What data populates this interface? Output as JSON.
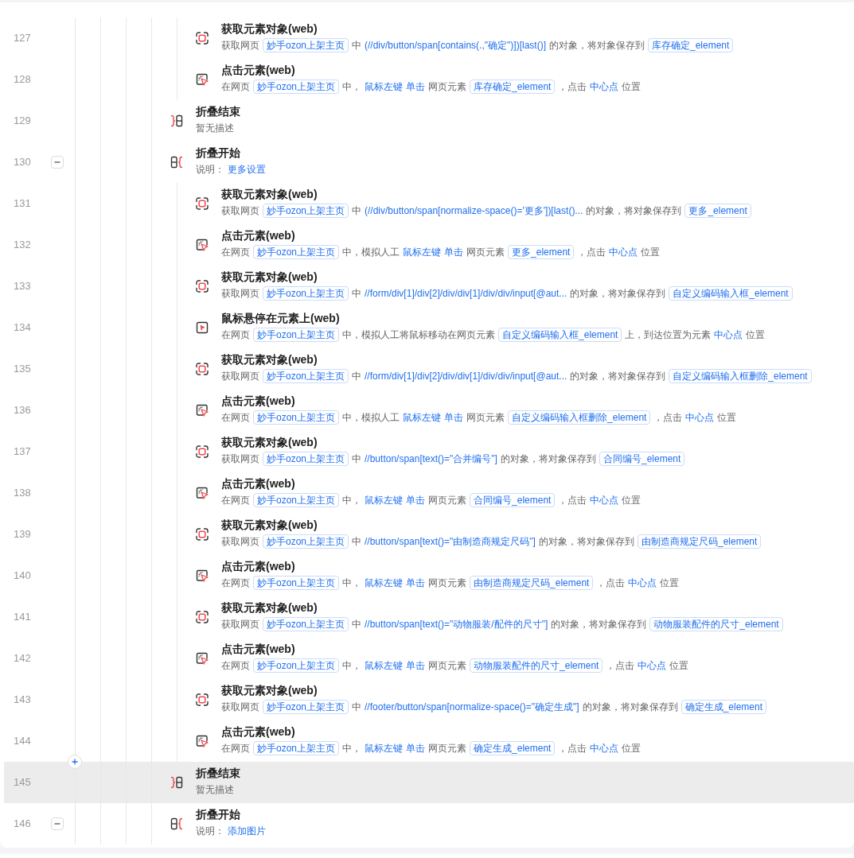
{
  "steps": [
    {
      "kind": "continuation",
      "children": [
        {
          "kind": "get_element",
          "line": "127",
          "title": "获取元素对象(web)",
          "selected": false,
          "description": [
            {
              "kind": "text",
              "text": "获取网页"
            },
            {
              "kind": "chip",
              "text": "妙手ozon上架主页"
            },
            {
              "kind": "text",
              "text": "中"
            },
            {
              "kind": "value",
              "text": "(//div/button/span[contains(.,\"确定\")])[last()]"
            },
            {
              "kind": "text",
              "text": "的对象，将对象保存到"
            },
            {
              "kind": "chip",
              "text": "库存确定_element"
            }
          ]
        },
        {
          "kind": "click",
          "line": "128",
          "title": "点击元素(web)",
          "selected": false,
          "description": [
            {
              "kind": "text",
              "text": "在网页"
            },
            {
              "kind": "chip",
              "text": "妙手ozon上架主页"
            },
            {
              "kind": "text",
              "text": "中，"
            },
            {
              "kind": "value",
              "text": "鼠标左键"
            },
            {
              "kind": "value",
              "text": "单击"
            },
            {
              "kind": "text",
              "text": "网页元素"
            },
            {
              "kind": "chip",
              "text": "库存确定_element"
            },
            {
              "kind": "text",
              "text": "，点击"
            },
            {
              "kind": "value",
              "text": "中心点"
            },
            {
              "kind": "text",
              "text": "位置"
            }
          ]
        }
      ]
    },
    {
      "kind": "fold_end",
      "line": "129",
      "title": "折叠结束",
      "selected": false,
      "description": [
        {
          "kind": "text",
          "text": "暂无描述"
        }
      ]
    },
    {
      "kind": "fold_start",
      "line": "130",
      "title": "折叠开始",
      "expanded": true,
      "selected": false,
      "description": [
        {
          "kind": "text",
          "text": "说明："
        },
        {
          "kind": "value",
          "text": "更多设置"
        }
      ],
      "children": [
        {
          "kind": "get_element",
          "line": "131",
          "title": "获取元素对象(web)",
          "selected": false,
          "description": [
            {
              "kind": "text",
              "text": "获取网页"
            },
            {
              "kind": "chip",
              "text": "妙手ozon上架主页"
            },
            {
              "kind": "text",
              "text": "中"
            },
            {
              "kind": "value",
              "text": "(//div/button/span[normalize-space()='更多'])[last()..."
            },
            {
              "kind": "text",
              "text": "的对象，将对象保存到"
            },
            {
              "kind": "chip",
              "text": "更多_element"
            }
          ]
        },
        {
          "kind": "click",
          "line": "132",
          "title": "点击元素(web)",
          "selected": false,
          "description": [
            {
              "kind": "text",
              "text": "在网页"
            },
            {
              "kind": "chip",
              "text": "妙手ozon上架主页"
            },
            {
              "kind": "text",
              "text": "中，模拟人工"
            },
            {
              "kind": "value",
              "text": "鼠标左键"
            },
            {
              "kind": "value",
              "text": "单击"
            },
            {
              "kind": "text",
              "text": "网页元素"
            },
            {
              "kind": "chip",
              "text": "更多_element"
            },
            {
              "kind": "text",
              "text": "，点击"
            },
            {
              "kind": "value",
              "text": "中心点"
            },
            {
              "kind": "text",
              "text": "位置"
            }
          ]
        },
        {
          "kind": "get_element",
          "line": "133",
          "title": "获取元素对象(web)",
          "selected": false,
          "description": [
            {
              "kind": "text",
              "text": "获取网页"
            },
            {
              "kind": "chip",
              "text": "妙手ozon上架主页"
            },
            {
              "kind": "text",
              "text": "中"
            },
            {
              "kind": "value",
              "text": "//form/div[1]/div[2]/div/div[1]/div/div/input[@aut..."
            },
            {
              "kind": "text",
              "text": "的对象，将对象保存到"
            },
            {
              "kind": "chip",
              "text": "自定义编码输入框_element"
            }
          ]
        },
        {
          "kind": "hover",
          "line": "134",
          "title": "鼠标悬停在元素上(web)",
          "selected": false,
          "description": [
            {
              "kind": "text",
              "text": "在网页"
            },
            {
              "kind": "chip",
              "text": "妙手ozon上架主页"
            },
            {
              "kind": "text",
              "text": "中，模拟人工将鼠标移动在网页元素"
            },
            {
              "kind": "chip",
              "text": "自定义编码输入框_element"
            },
            {
              "kind": "text",
              "text": "上，到达位置为元素"
            },
            {
              "kind": "value",
              "text": "中心点"
            },
            {
              "kind": "text",
              "text": "位置"
            }
          ]
        },
        {
          "kind": "get_element",
          "line": "135",
          "title": "获取元素对象(web)",
          "selected": false,
          "description": [
            {
              "kind": "text",
              "text": "获取网页"
            },
            {
              "kind": "chip",
              "text": "妙手ozon上架主页"
            },
            {
              "kind": "text",
              "text": "中"
            },
            {
              "kind": "value",
              "text": "//form/div[1]/div[2]/div/div[1]/div/div/input[@aut..."
            },
            {
              "kind": "text",
              "text": "的对象，将对象保存到"
            },
            {
              "kind": "chip",
              "text": "自定义编码输入框删除_element"
            }
          ]
        },
        {
          "kind": "click",
          "line": "136",
          "title": "点击元素(web)",
          "selected": false,
          "description": [
            {
              "kind": "text",
              "text": "在网页"
            },
            {
              "kind": "chip",
              "text": "妙手ozon上架主页"
            },
            {
              "kind": "text",
              "text": "中，模拟人工"
            },
            {
              "kind": "value",
              "text": "鼠标左键"
            },
            {
              "kind": "value",
              "text": "单击"
            },
            {
              "kind": "text",
              "text": "网页元素"
            },
            {
              "kind": "chip",
              "text": "自定义编码输入框删除_element"
            },
            {
              "kind": "text",
              "text": "，点击"
            },
            {
              "kind": "value",
              "text": "中心点"
            },
            {
              "kind": "text",
              "text": "位置"
            }
          ]
        },
        {
          "kind": "get_element",
          "line": "137",
          "title": "获取元素对象(web)",
          "selected": false,
          "description": [
            {
              "kind": "text",
              "text": "获取网页"
            },
            {
              "kind": "chip",
              "text": "妙手ozon上架主页"
            },
            {
              "kind": "text",
              "text": "中"
            },
            {
              "kind": "value",
              "text": "//button/span[text()=\"合并编号\"]"
            },
            {
              "kind": "text",
              "text": "的对象，将对象保存到"
            },
            {
              "kind": "chip",
              "text": "合同编号_element"
            }
          ]
        },
        {
          "kind": "click",
          "line": "138",
          "title": "点击元素(web)",
          "selected": false,
          "description": [
            {
              "kind": "text",
              "text": "在网页"
            },
            {
              "kind": "chip",
              "text": "妙手ozon上架主页"
            },
            {
              "kind": "text",
              "text": "中，"
            },
            {
              "kind": "value",
              "text": "鼠标左键"
            },
            {
              "kind": "value",
              "text": "单击"
            },
            {
              "kind": "text",
              "text": "网页元素"
            },
            {
              "kind": "chip",
              "text": "合同编号_element"
            },
            {
              "kind": "text",
              "text": "，点击"
            },
            {
              "kind": "value",
              "text": "中心点"
            },
            {
              "kind": "text",
              "text": "位置"
            }
          ]
        },
        {
          "kind": "get_element",
          "line": "139",
          "title": "获取元素对象(web)",
          "selected": false,
          "description": [
            {
              "kind": "text",
              "text": "获取网页"
            },
            {
              "kind": "chip",
              "text": "妙手ozon上架主页"
            },
            {
              "kind": "text",
              "text": "中"
            },
            {
              "kind": "value",
              "text": "//button/span[text()=\"由制造商规定尺码\"]"
            },
            {
              "kind": "text",
              "text": "的对象，将对象保存到"
            },
            {
              "kind": "chip",
              "text": "由制造商规定尺码_element"
            }
          ]
        },
        {
          "kind": "click",
          "line": "140",
          "title": "点击元素(web)",
          "selected": false,
          "description": [
            {
              "kind": "text",
              "text": "在网页"
            },
            {
              "kind": "chip",
              "text": "妙手ozon上架主页"
            },
            {
              "kind": "text",
              "text": "中，"
            },
            {
              "kind": "value",
              "text": "鼠标左键"
            },
            {
              "kind": "value",
              "text": "单击"
            },
            {
              "kind": "text",
              "text": "网页元素"
            },
            {
              "kind": "chip",
              "text": "由制造商规定尺码_element"
            },
            {
              "kind": "text",
              "text": "，点击"
            },
            {
              "kind": "value",
              "text": "中心点"
            },
            {
              "kind": "text",
              "text": "位置"
            }
          ]
        },
        {
          "kind": "get_element",
          "line": "141",
          "title": "获取元素对象(web)",
          "selected": false,
          "description": [
            {
              "kind": "text",
              "text": "获取网页"
            },
            {
              "kind": "chip",
              "text": "妙手ozon上架主页"
            },
            {
              "kind": "text",
              "text": "中"
            },
            {
              "kind": "value",
              "text": "//button/span[text()=\"动物服装/配件的尺寸\"]"
            },
            {
              "kind": "text",
              "text": "的对象，将对象保存到"
            },
            {
              "kind": "chip",
              "text": "动物服装配件的尺寸_element"
            }
          ]
        },
        {
          "kind": "click",
          "line": "142",
          "title": "点击元素(web)",
          "selected": false,
          "description": [
            {
              "kind": "text",
              "text": "在网页"
            },
            {
              "kind": "chip",
              "text": "妙手ozon上架主页"
            },
            {
              "kind": "text",
              "text": "中，"
            },
            {
              "kind": "value",
              "text": "鼠标左键"
            },
            {
              "kind": "value",
              "text": "单击"
            },
            {
              "kind": "text",
              "text": "网页元素"
            },
            {
              "kind": "chip",
              "text": "动物服装配件的尺寸_element"
            },
            {
              "kind": "text",
              "text": "，点击"
            },
            {
              "kind": "value",
              "text": "中心点"
            },
            {
              "kind": "text",
              "text": "位置"
            }
          ]
        },
        {
          "kind": "get_element",
          "line": "143",
          "title": "获取元素对象(web)",
          "selected": false,
          "description": [
            {
              "kind": "text",
              "text": "获取网页"
            },
            {
              "kind": "chip",
              "text": "妙手ozon上架主页"
            },
            {
              "kind": "text",
              "text": "中"
            },
            {
              "kind": "value",
              "text": "//footer/button/span[normalize-space()=\"确定生成\"]"
            },
            {
              "kind": "text",
              "text": "的对象，将对象保存到"
            },
            {
              "kind": "chip",
              "text": "确定生成_element"
            }
          ]
        },
        {
          "kind": "click",
          "line": "144",
          "title": "点击元素(web)",
          "selected": false,
          "description": [
            {
              "kind": "text",
              "text": "在网页"
            },
            {
              "kind": "chip",
              "text": "妙手ozon上架主页"
            },
            {
              "kind": "text",
              "text": "中，"
            },
            {
              "kind": "value",
              "text": "鼠标左键"
            },
            {
              "kind": "value",
              "text": "单击"
            },
            {
              "kind": "text",
              "text": "网页元素"
            },
            {
              "kind": "chip",
              "text": "确定生成_element"
            },
            {
              "kind": "text",
              "text": "，点击"
            },
            {
              "kind": "value",
              "text": "中心点"
            },
            {
              "kind": "text",
              "text": "位置"
            }
          ]
        }
      ]
    },
    {
      "kind": "fold_end",
      "line": "145",
      "title": "折叠结束",
      "selected": true,
      "description": [
        {
          "kind": "text",
          "text": "暂无描述"
        }
      ]
    },
    {
      "kind": "fold_start",
      "line": "146",
      "title": "折叠开始",
      "expanded": true,
      "selected": false,
      "description": [
        {
          "kind": "text",
          "text": "说明："
        },
        {
          "kind": "value",
          "text": "添加图片"
        }
      ]
    }
  ]
}
